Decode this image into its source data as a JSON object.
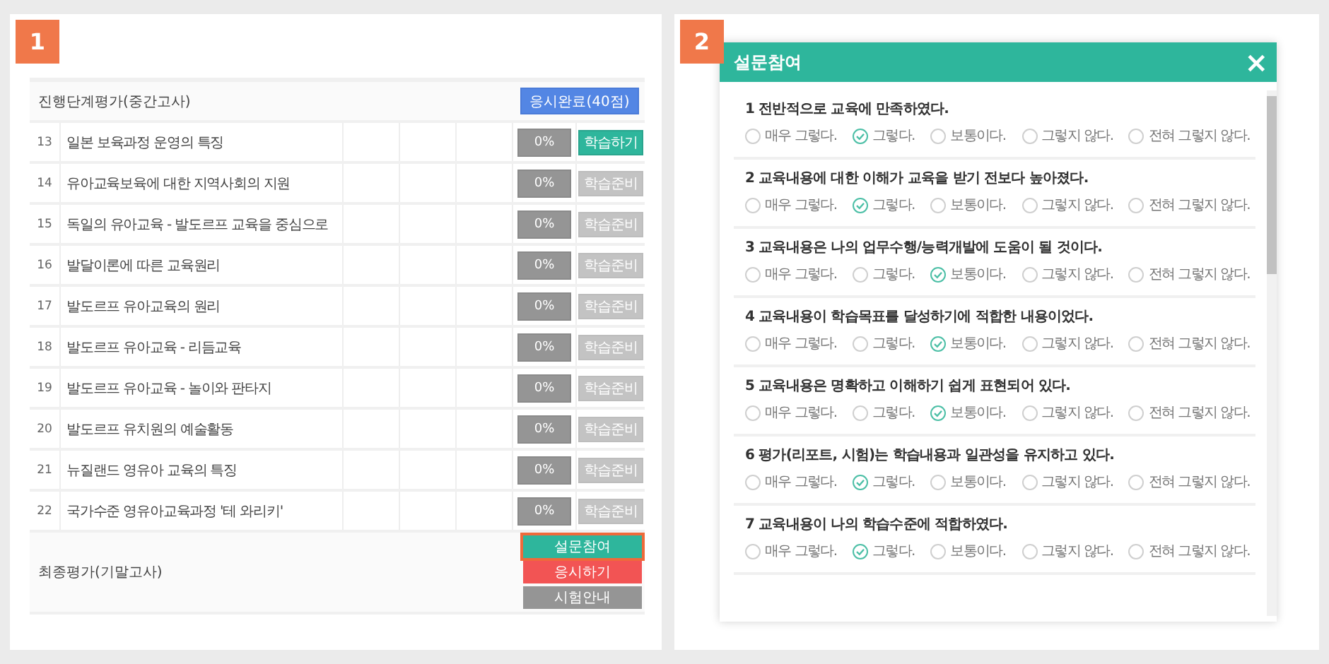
{
  "panels": [
    {
      "badge": "1"
    },
    {
      "badge": "2"
    }
  ],
  "course_table": {
    "section_header": {
      "label": "진행단계평가(중간고사)",
      "button": "응시완료(40점)"
    },
    "rows": [
      {
        "number": "13",
        "title": "일본 보육과정 운영의 특징",
        "progress": "0%",
        "action": "학습하기",
        "active": true
      },
      {
        "number": "14",
        "title": "유아교육보육에 대한 지역사회의 지원",
        "progress": "0%",
        "action": "학습준비",
        "active": false
      },
      {
        "number": "15",
        "title": "독일의 유아교육 - 발도르프 교육을 중심으로",
        "progress": "0%",
        "action": "학습준비",
        "active": false
      },
      {
        "number": "16",
        "title": "발달이론에 따른 교육원리",
        "progress": "0%",
        "action": "학습준비",
        "active": false
      },
      {
        "number": "17",
        "title": "발도르프 유아교육의 원리",
        "progress": "0%",
        "action": "학습준비",
        "active": false
      },
      {
        "number": "18",
        "title": "발도르프 유아교육 - 리듬교육",
        "progress": "0%",
        "action": "학습준비",
        "active": false
      },
      {
        "number": "19",
        "title": "발도르프 유아교육 - 놀이와 판타지",
        "progress": "0%",
        "action": "학습준비",
        "active": false
      },
      {
        "number": "20",
        "title": "발도르프 유치원의 예술활동",
        "progress": "0%",
        "action": "학습준비",
        "active": false
      },
      {
        "number": "21",
        "title": "뉴질랜드 영유아 교육의 특징",
        "progress": "0%",
        "action": "학습준비",
        "active": false
      },
      {
        "number": "22",
        "title": "국가수준 영유아교육과정 '테 와리키'",
        "progress": "0%",
        "action": "학습준비",
        "active": false
      }
    ],
    "final": {
      "label": "최종평가(기말고사)",
      "buttons": [
        {
          "label": "설문참여",
          "kind": "survey",
          "highlighted": true
        },
        {
          "label": "응시하기",
          "kind": "exam",
          "highlighted": false
        },
        {
          "label": "시험안내",
          "kind": "guide",
          "highlighted": false
        }
      ]
    }
  },
  "survey_dialog": {
    "title": "설문참여",
    "close": "×",
    "questions": [
      {
        "text": "1 전반적으로 교육에 만족하였다.",
        "options": [
          {
            "label": "매우 그렇다.",
            "selected": false
          },
          {
            "label": "그렇다.",
            "selected": true
          },
          {
            "label": "보통이다.",
            "selected": false
          },
          {
            "label": "그렇지 않다.",
            "selected": false
          },
          {
            "label": "전혀 그렇지 않다.",
            "selected": false
          }
        ]
      },
      {
        "text": "2 교육내용에 대한 이해가 교육을 받기 전보다 높아졌다.",
        "options": [
          {
            "label": "매우 그렇다.",
            "selected": false
          },
          {
            "label": "그렇다.",
            "selected": true
          },
          {
            "label": "보통이다.",
            "selected": false
          },
          {
            "label": "그렇지 않다.",
            "selected": false
          },
          {
            "label": "전혀 그렇지 않다.",
            "selected": false
          }
        ]
      },
      {
        "text": "3 교육내용은 나의 업무수행/능력개발에 도움이 될 것이다.",
        "options": [
          {
            "label": "매우 그렇다.",
            "selected": false
          },
          {
            "label": "그렇다.",
            "selected": false
          },
          {
            "label": "보통이다.",
            "selected": true
          },
          {
            "label": "그렇지 않다.",
            "selected": false
          },
          {
            "label": "전혀 그렇지 않다.",
            "selected": false
          }
        ]
      },
      {
        "text": "4 교육내용이 학습목표를 달성하기에 적합한 내용이었다.",
        "options": [
          {
            "label": "매우 그렇다.",
            "selected": false
          },
          {
            "label": "그렇다.",
            "selected": false
          },
          {
            "label": "보통이다.",
            "selected": true
          },
          {
            "label": "그렇지 않다.",
            "selected": false
          },
          {
            "label": "전혀 그렇지 않다.",
            "selected": false
          }
        ]
      },
      {
        "text": "5 교육내용은 명확하고 이해하기 쉽게 표현되어 있다.",
        "options": [
          {
            "label": "매우 그렇다.",
            "selected": false
          },
          {
            "label": "그렇다.",
            "selected": false
          },
          {
            "label": "보통이다.",
            "selected": true
          },
          {
            "label": "그렇지 않다.",
            "selected": false
          },
          {
            "label": "전혀 그렇지 않다.",
            "selected": false
          }
        ]
      },
      {
        "text": "6 평가(리포트, 시험)는 학습내용과 일관성을 유지하고 있다.",
        "options": [
          {
            "label": "매우 그렇다.",
            "selected": false
          },
          {
            "label": "그렇다.",
            "selected": true
          },
          {
            "label": "보통이다.",
            "selected": false
          },
          {
            "label": "그렇지 않다.",
            "selected": false
          },
          {
            "label": "전혀 그렇지 않다.",
            "selected": false
          }
        ]
      },
      {
        "text": "7 교육내용이 나의 학습수준에 적합하였다.",
        "options": [
          {
            "label": "매우 그렇다.",
            "selected": false
          },
          {
            "label": "그렇다.",
            "selected": true
          },
          {
            "label": "보통이다.",
            "selected": false
          },
          {
            "label": "그렇지 않다.",
            "selected": false
          },
          {
            "label": "전혀 그렇지 않다.",
            "selected": false
          }
        ]
      }
    ]
  }
}
